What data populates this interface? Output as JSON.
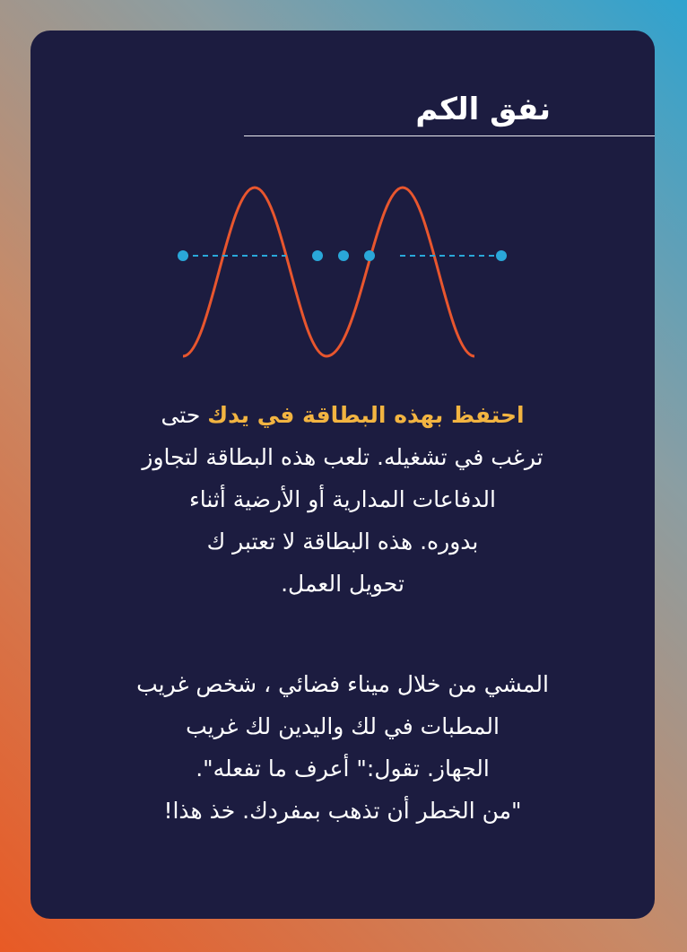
{
  "card": {
    "title": "نفق الكم",
    "paragraph1": {
      "highlight": "احتفظ بهذه البطاقة في يدك",
      "line1_rest": "حتى",
      "lines": [
        "ترغب في تشغيله. تلعب هذه البطاقة لتجاوز",
        "الدفاعات المدارية أو الأرضية أثناء",
        "بدوره. هذه البطاقة لا تعتبر ك",
        "تحويل العمل."
      ]
    },
    "paragraph2": {
      "lines": [
        "المشي من خلال ميناء فضائي ، شخص غريب",
        "المطبات في لك واليدين لك غريب",
        "الجهاز. تقول:\" أعرف ما تفعله\".",
        "\"من الخطر أن تذهب بمفردك. خذ هذا!"
      ]
    }
  },
  "colors": {
    "card_background": "#1c1c40",
    "highlight": "#f2b441",
    "wave": "#e8562e",
    "dots": "#2aa7d9",
    "text": "#ffffff"
  },
  "icons": {
    "illustration": "quantum-tunnel-wave"
  }
}
